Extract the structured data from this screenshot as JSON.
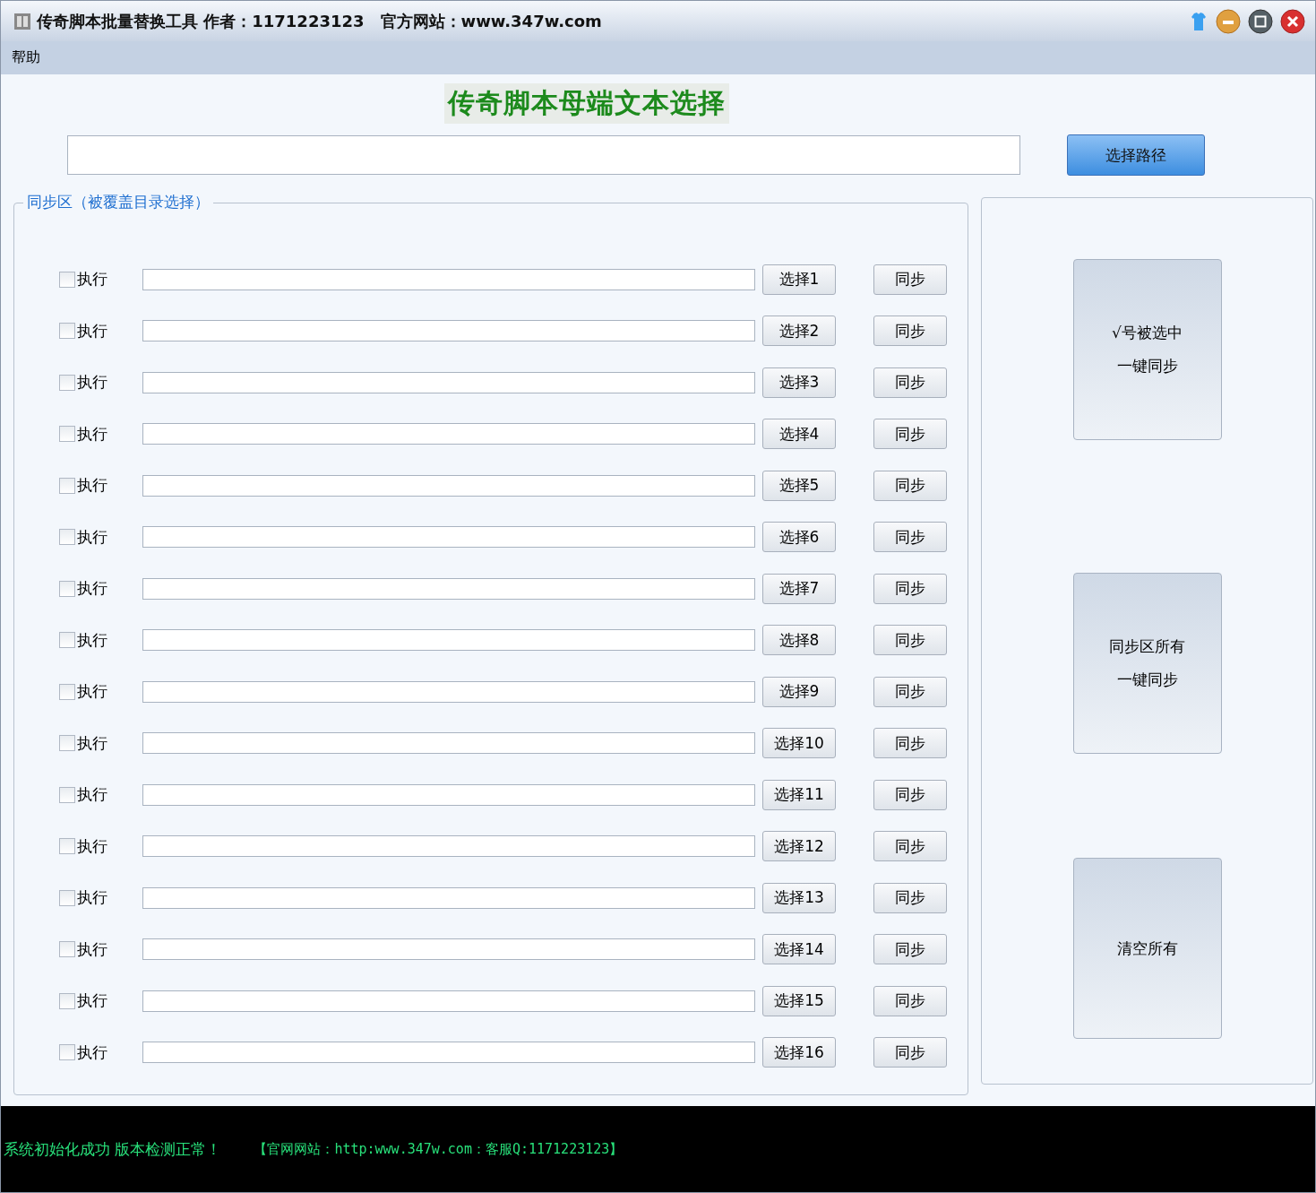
{
  "window": {
    "title": "传奇脚本批量替换工具 作者：1171223123　官方网站：www.347w.com"
  },
  "menu": [
    {
      "label": "帮助"
    }
  ],
  "heading": "传奇脚本母端文本选择",
  "path_picker": {
    "button": "选择路径"
  },
  "sync_group": {
    "title": "同步区（被覆盖目录选择）",
    "rows": [
      {
        "label": "执行",
        "checked": false,
        "select": "选择1",
        "sync": "同步"
      },
      {
        "label": "执行",
        "checked": false,
        "select": "选择2",
        "sync": "同步"
      },
      {
        "label": "执行",
        "checked": false,
        "select": "选择3",
        "sync": "同步"
      },
      {
        "label": "执行",
        "checked": false,
        "select": "选择4",
        "sync": "同步"
      },
      {
        "label": "执行",
        "checked": false,
        "select": "选择5",
        "sync": "同步"
      },
      {
        "label": "执行",
        "checked": false,
        "select": "选择6",
        "sync": "同步"
      },
      {
        "label": "执行",
        "checked": false,
        "select": "选择7",
        "sync": "同步"
      },
      {
        "label": "执行",
        "checked": false,
        "select": "选择8",
        "sync": "同步"
      },
      {
        "label": "执行",
        "checked": false,
        "select": "选择9",
        "sync": "同步"
      },
      {
        "label": "执行",
        "checked": false,
        "select": "选择10",
        "sync": "同步"
      },
      {
        "label": "执行",
        "checked": false,
        "select": "选择11",
        "sync": "同步"
      },
      {
        "label": "执行",
        "checked": false,
        "select": "选择12",
        "sync": "同步"
      },
      {
        "label": "执行",
        "checked": false,
        "select": "选择13",
        "sync": "同步"
      },
      {
        "label": "执行",
        "checked": false,
        "select": "选择14",
        "sync": "同步"
      },
      {
        "label": "执行",
        "checked": false,
        "select": "选择15",
        "sync": "同步"
      },
      {
        "label": "执行",
        "checked": false,
        "select": "选择16",
        "sync": "同步"
      }
    ]
  },
  "actions": [
    {
      "lines": [
        "√号被选中",
        "一键同步"
      ]
    },
    {
      "lines": [
        "同步区所有",
        "一键同步"
      ]
    },
    {
      "lines": [
        "清空所有"
      ]
    }
  ],
  "status_bar": {
    "message": "系统初始化成功 版本检测正常！",
    "info": "【官网网站：http:www.347w.com：客服Q:1171223123】"
  }
}
